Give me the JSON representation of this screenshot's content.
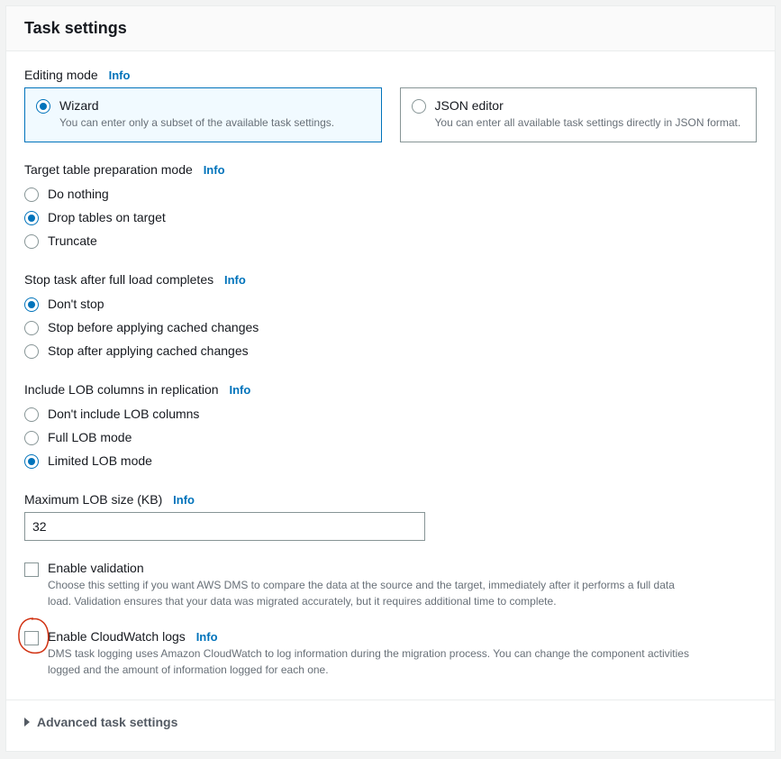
{
  "header": {
    "title": "Task settings"
  },
  "info_label": "Info",
  "editing_mode": {
    "label": "Editing mode",
    "wizard": {
      "title": "Wizard",
      "desc": "You can enter only a subset of the available task settings.",
      "selected": true
    },
    "json": {
      "title": "JSON editor",
      "desc": "You can enter all available task settings directly in JSON format.",
      "selected": false
    }
  },
  "target_prep": {
    "label": "Target table preparation mode",
    "options": [
      {
        "label": "Do nothing",
        "selected": false
      },
      {
        "label": "Drop tables on target",
        "selected": true
      },
      {
        "label": "Truncate",
        "selected": false
      }
    ]
  },
  "stop_task": {
    "label": "Stop task after full load completes",
    "options": [
      {
        "label": "Don't stop",
        "selected": true
      },
      {
        "label": "Stop before applying cached changes",
        "selected": false
      },
      {
        "label": "Stop after applying cached changes",
        "selected": false
      }
    ]
  },
  "lob": {
    "label": "Include LOB columns in replication",
    "options": [
      {
        "label": "Don't include LOB columns",
        "selected": false
      },
      {
        "label": "Full LOB mode",
        "selected": false
      },
      {
        "label": "Limited LOB mode",
        "selected": true
      }
    ]
  },
  "max_lob": {
    "label": "Maximum LOB size (KB)",
    "value": "32"
  },
  "enable_validation": {
    "label": "Enable validation",
    "desc": "Choose this setting if you want AWS DMS to compare the data at the source and the target, immediately after it performs a full data load. Validation ensures that your data was migrated accurately, but it requires additional time to complete.",
    "checked": false
  },
  "enable_cloudwatch": {
    "label": "Enable CloudWatch logs",
    "desc": "DMS task logging uses Amazon CloudWatch to log information during the migration process. You can change the component activities logged and the amount of information logged for each one.",
    "checked": false
  },
  "advanced": {
    "label": "Advanced task settings"
  }
}
